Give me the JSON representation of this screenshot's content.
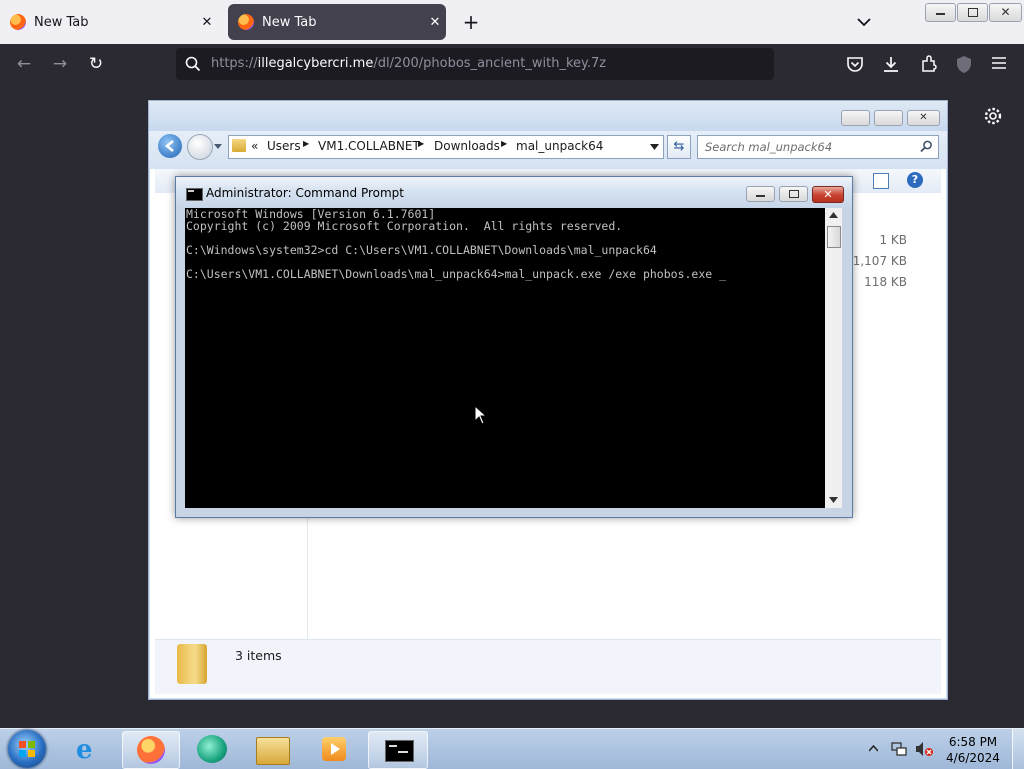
{
  "browser": {
    "tabs": [
      {
        "title": "New Tab",
        "active": false
      },
      {
        "title": "New Tab",
        "active": true
      }
    ],
    "url_prefix": "https://",
    "url_domain": "illegalcybercri.me",
    "url_path": "/dl/200/phobos_ancient_with_key.7z"
  },
  "explorer": {
    "breadcrumb_chevrons": "«",
    "breadcrumb": [
      "Users",
      "VM1.COLLABNET",
      "Downloads",
      "mal_unpack64"
    ],
    "search_placeholder": "Search mal_unpack64",
    "sizes": [
      "1 KB",
      "1,107 KB",
      "118 KB"
    ],
    "status": "3 items"
  },
  "cmd": {
    "title": "Administrator: Command Prompt",
    "lines": [
      "Microsoft Windows [Version 6.1.7601]",
      "Copyright (c) 2009 Microsoft Corporation.  All rights reserved.",
      "",
      "C:\\Windows\\system32>cd C:\\Users\\VM1.COLLABNET\\Downloads\\mal_unpack64",
      "",
      "C:\\Users\\VM1.COLLABNET\\Downloads\\mal_unpack64>mal_unpack.exe /exe phobos.exe _"
    ]
  },
  "taskbar": {
    "time": "6:58 PM",
    "date": "4/6/2024"
  },
  "colors": {
    "firefox_dark": "#2b2a33",
    "cmd_bg": "#000000",
    "cmd_text": "#c0c0c0",
    "close_red": "#c7402e"
  }
}
